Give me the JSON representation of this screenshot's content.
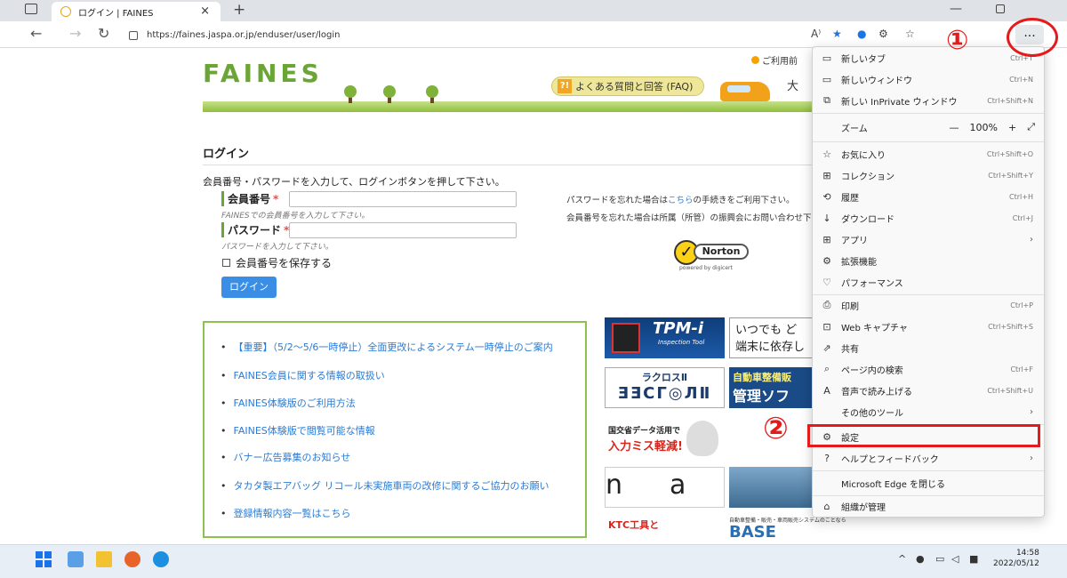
{
  "browser": {
    "tab_title": "ログイン | FAINES",
    "url": "https://faines.jaspa.or.jp/enduser/user/login",
    "read_aloud_icon": "A⁾",
    "more_label": "..."
  },
  "header": {
    "logo": "FAINES",
    "faq": "よくある質問と回答 (FAQ)",
    "notice": "ご利用前",
    "ai_label": "大"
  },
  "login": {
    "title": "ログイン",
    "instruction": "会員番号・パスワードを入力して、ログインボタンを押して下さい。",
    "member_label": "会員番号",
    "member_help": "FAINESでの会員番号を入力して下さい。",
    "password_label": "パスワード",
    "password_help": "パスワードを入力して下さい。",
    "required_mark": "*",
    "save_label": "会員番号を保存する",
    "button": "ログイン",
    "forgot_pw_pre": "パスワードを忘れた場合は",
    "forgot_pw_link": "こちら",
    "forgot_pw_post": "の手続きをご利用下さい。",
    "forgot_id": "会員番号を忘れた場合は所属（所管）の振興会にお問い合わせ下",
    "norton_check": "✓",
    "norton": "Norton",
    "norton_powered": "powered by digicert"
  },
  "news": [
    "【重要】（5/2～5/6一時停止）全面更改によるシステム一時停止のご案内",
    "FAINES会員に関する情報の取扱い",
    "FAINES体験版のご利用方法",
    "FAINES体験版で閲覧可能な情報",
    "バナー広告募集のお知らせ",
    "タカタ製エアバッグ リコール未実施車両の改修に関するご協力のお願い",
    "登録情報内容一覧はこちら"
  ],
  "ads": {
    "tpm_big": "TPM-i",
    "tpm_small": "Inspection Tool",
    "itsumo_1": "いつでも ど",
    "itsumo_2": "端末に依存し",
    "lacross_1": "ラクロスⅡ",
    "lacross_2": "ƎƎCГ◎ЛⅡ",
    "jidosha_1": "自動車整備販",
    "jidosha_2": "管理ソフ",
    "kokkosho_1": "国交省データ活用で",
    "kokkosho_2": "入力ミス軽減!",
    "n_a": "n",
    "n_b": "a",
    "ktc": "KTC工具と",
    "base_small": "自動車整備・販売・車両販売システムのことなら",
    "base_big": "BASE"
  },
  "menu": {
    "items": [
      {
        "icon": "▭",
        "label": "新しいタブ",
        "shortcut": "Ctrl+T"
      },
      {
        "icon": "▭",
        "label": "新しいウィンドウ",
        "shortcut": "Ctrl+N"
      },
      {
        "icon": "⧉",
        "label": "新しい InPrivate ウィンドウ",
        "shortcut": "Ctrl+Shift+N"
      },
      {
        "icon": "",
        "label": "ズーム",
        "shortcut": ""
      },
      {
        "icon": "☆",
        "label": "お気に入り",
        "shortcut": "Ctrl+Shift+O"
      },
      {
        "icon": "⊞",
        "label": "コレクション",
        "shortcut": "Ctrl+Shift+Y"
      },
      {
        "icon": "⟲",
        "label": "履歴",
        "shortcut": "Ctrl+H"
      },
      {
        "icon": "↓",
        "label": "ダウンロード",
        "shortcut": "Ctrl+J"
      },
      {
        "icon": "⊞",
        "label": "アプリ",
        "shortcut": ""
      },
      {
        "icon": "⚙",
        "label": "拡張機能",
        "shortcut": ""
      },
      {
        "icon": "♡",
        "label": "パフォーマンス",
        "shortcut": ""
      },
      {
        "icon": "⎙",
        "label": "印刷",
        "shortcut": "Ctrl+P"
      },
      {
        "icon": "⊡",
        "label": "Web キャプチャ",
        "shortcut": "Ctrl+Shift+S"
      },
      {
        "icon": "⇗",
        "label": "共有",
        "shortcut": ""
      },
      {
        "icon": "⌕",
        "label": "ページ内の検索",
        "shortcut": "Ctrl+F"
      },
      {
        "icon": "A",
        "label": "音声で読み上げる",
        "shortcut": "Ctrl+Shift+U"
      },
      {
        "icon": "",
        "label": "その他のツール",
        "shortcut": ""
      },
      {
        "icon": "⚙",
        "label": "設定",
        "shortcut": ""
      },
      {
        "icon": "?",
        "label": "ヘルプとフィードバック",
        "shortcut": ""
      },
      {
        "icon": "",
        "label": "Microsoft Edge を閉じる",
        "shortcut": ""
      },
      {
        "icon": "⌂",
        "label": "組織が管理",
        "shortcut": ""
      }
    ],
    "zoom_minus": "—",
    "zoom_value": "100%",
    "zoom_plus": "+",
    "zoom_full": "⤢",
    "submenu_arrow": "›"
  },
  "annotations": {
    "num1": "①",
    "num2": "②"
  },
  "taskbar": {
    "time": "14:58",
    "date": "2022/05/12"
  }
}
